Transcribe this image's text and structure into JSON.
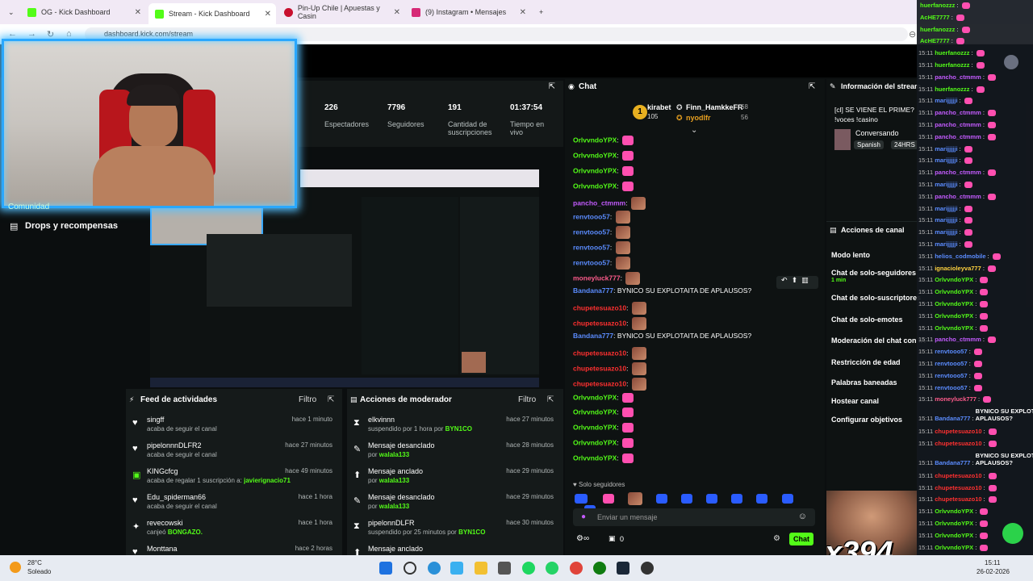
{
  "browser": {
    "tabs": [
      {
        "label": "OG - Kick Dashboard",
        "fav": "#53fc18"
      },
      {
        "label": "Stream - Kick Dashboard",
        "fav": "#53fc18"
      },
      {
        "label": "Pin-Up Chile | Apuestas y Casin",
        "fav": "#c8102e"
      },
      {
        "label": "(9) Instagram • Mensajes",
        "fav": "#d62976"
      }
    ],
    "url": "dashboard.kick.com/stream"
  },
  "stats": [
    {
      "num": "226",
      "label": "Espectadores"
    },
    {
      "num": "7796",
      "label": "Seguidores"
    },
    {
      "num": "191",
      "label": "Cantidad de suscripciones"
    },
    {
      "num": "01:37:54",
      "label": "Tiempo en vivo"
    }
  ],
  "sidebar": {
    "comunidad": "Comunidad",
    "drops": "Drops y recompensas"
  },
  "activity": {
    "title": "Feed de actividades",
    "filter": "Filtro",
    "items": [
      {
        "name": "singff",
        "sub": "acaba de seguir el canal",
        "time": "hace 1 minuto"
      },
      {
        "name": "pipelonnnDLFR2",
        "sub": "acaba de seguir el canal",
        "time": "hace 27 minutos"
      },
      {
        "name": "KINGcfcg",
        "sub": "acaba de regalar 1 suscripción a:",
        "sub2": "javierignacio71",
        "time": "hace 49 minutos"
      },
      {
        "name": "Edu_spiderman66",
        "sub": "acaba de seguir el canal",
        "time": "hace 1 hora"
      },
      {
        "name": "revecowski",
        "sub": "canjeó",
        "sub2": "BONGAZO.",
        "time": "hace 1 hora"
      },
      {
        "name": "Monttana",
        "sub": "",
        "time": "hace 2 horas"
      }
    ]
  },
  "mod": {
    "title": "Acciones de moderador",
    "filter": "Filtro",
    "items": [
      {
        "name": "elkvinnn",
        "sub": "suspendido por 1 hora por",
        "sub2": "BYN1CO",
        "time": "hace 27 minutos"
      },
      {
        "name": "Mensaje desanclado",
        "sub": "por",
        "sub2": "walala133",
        "time": "hace 28 minutos"
      },
      {
        "name": "Mensaje anclado",
        "sub": "por",
        "sub2": "walala133",
        "time": "hace 29 minutos"
      },
      {
        "name": "Mensaje desanclado",
        "sub": "por",
        "sub2": "walala133",
        "time": "hace 29 minutos"
      },
      {
        "name": "pipelonnDLFR",
        "sub": "suspendido por 25 minutos por",
        "sub2": "BYN1CO",
        "time": "hace 30 minutos"
      },
      {
        "name": "Mensaje anclado",
        "sub": "",
        "time": ""
      }
    ]
  },
  "chat": {
    "title": "Chat",
    "leaders": [
      {
        "name": "kirabet",
        "count": "105"
      },
      {
        "name": "Finn_HamkkeFR",
        "count": "68"
      },
      {
        "name": "nyodlfr",
        "count": "56"
      }
    ],
    "messages": [
      {
        "user": "OrlvvndoYPX",
        "color": "#53fc18",
        "text": ""
      },
      {
        "user": "OrlvvndoYPX",
        "color": "#53fc18",
        "text": ""
      },
      {
        "user": "OrlvvndoYPX",
        "color": "#53fc18",
        "text": ""
      },
      {
        "user": "OrlvvndoYPX",
        "color": "#53fc18",
        "text": ""
      },
      {
        "user": "pancho_ctmmm",
        "color": "#c45bff",
        "text": ""
      },
      {
        "user": "renvtooo57",
        "color": "#5b8cff",
        "text": ""
      },
      {
        "user": "renvtooo57",
        "color": "#5b8cff",
        "text": ""
      },
      {
        "user": "renvtooo57",
        "color": "#5b8cff",
        "text": ""
      },
      {
        "user": "renvtooo57",
        "color": "#5b8cff",
        "text": ""
      },
      {
        "user": "moneyluck777",
        "color": "#ff5b8c",
        "text": ""
      },
      {
        "user": "Bandana777",
        "color": "#5b8cff",
        "text": "BYNICO SU EXPLOTAITA DE APLAUSOS?"
      },
      {
        "user": "chupetesuazo10",
        "color": "#ff3030",
        "text": ""
      },
      {
        "user": "chupetesuazo10",
        "color": "#ff3030",
        "text": ""
      },
      {
        "user": "Bandana777",
        "color": "#5b8cff",
        "text": "BYNICO SU EXPLOTAITA DE APLAUSOS?"
      },
      {
        "user": "chupetesuazo10",
        "color": "#ff3030",
        "text": ""
      },
      {
        "user": "chupetesuazo10",
        "color": "#ff3030",
        "text": ""
      },
      {
        "user": "chupetesuazo10",
        "color": "#ff3030",
        "text": ""
      },
      {
        "user": "OrlvvndoYPX",
        "color": "#53fc18",
        "text": ""
      },
      {
        "user": "OrlvvndoYPX",
        "color": "#53fc18",
        "text": ""
      },
      {
        "user": "OrlvvndoYPX",
        "color": "#53fc18",
        "text": ""
      },
      {
        "user": "OrlvvndoYPX",
        "color": "#53fc18",
        "text": ""
      },
      {
        "user": "OrlvvndoYPX",
        "color": "#53fc18",
        "text": ""
      }
    ],
    "followers_only": "Solo seguidores",
    "placeholder": "Enviar un mensaje",
    "viewers_count": "0",
    "send": "Chat"
  },
  "info": {
    "title": "Información del stream",
    "stream_title": "[cl] SE VIENE EL PRIME? !voces !casino",
    "category": "Conversando",
    "tags": [
      "Spanish",
      "24HRS"
    ]
  },
  "actions": {
    "title": "Acciones de canal",
    "items": [
      "Modo lento",
      "Chat de solo-seguidores",
      "Chat de solo-suscriptores",
      "Chat de solo-emotes",
      "Moderación del chat con IA",
      "Restricción de edad",
      "Palabras baneadas",
      "Hostear canal",
      "Configurar objetivos"
    ],
    "followers_duration": "1 min"
  },
  "overlay": {
    "lines": [
      {
        "time": "",
        "user": "huerfanozzz",
        "color": "#53fc18"
      },
      {
        "time": "",
        "user": "AcHE7777",
        "color": "#53fc18"
      },
      {
        "time": "",
        "user": "huerfanozzz",
        "color": "#53fc18"
      },
      {
        "time": "",
        "user": "AcHE7777",
        "color": "#53fc18"
      },
      {
        "time": "15:11",
        "user": "huerfanozzz",
        "color": "#53fc18"
      },
      {
        "time": "15:11",
        "user": "huerfanozzz",
        "color": "#53fc18"
      },
      {
        "time": "15:11",
        "user": "pancho_ctmmm",
        "color": "#c45bff"
      },
      {
        "time": "15:11",
        "user": "huerfanozzz",
        "color": "#53fc18"
      },
      {
        "time": "15:11",
        "user": "marijjjjji",
        "color": "#5b8cff"
      },
      {
        "time": "15:11",
        "user": "pancho_ctmmm",
        "color": "#c45bff"
      },
      {
        "time": "15:11",
        "user": "pancho_ctmmm",
        "color": "#c45bff"
      },
      {
        "time": "15:11",
        "user": "pancho_ctmmm",
        "color": "#c45bff"
      },
      {
        "time": "15:11",
        "user": "marijjjjji",
        "color": "#5b8cff"
      },
      {
        "time": "15:11",
        "user": "marijjjjji",
        "color": "#5b8cff"
      },
      {
        "time": "15:11",
        "user": "pancho_ctmmm",
        "color": "#c45bff"
      },
      {
        "time": "15:11",
        "user": "marijjjjji",
        "color": "#5b8cff"
      },
      {
        "time": "15:11",
        "user": "pancho_ctmmm",
        "color": "#c45bff"
      },
      {
        "time": "15:11",
        "user": "marijjjjji",
        "color": "#5b8cff"
      },
      {
        "time": "15:11",
        "user": "marijjjjji",
        "color": "#5b8cff"
      },
      {
        "time": "15:11",
        "user": "marijjjjji",
        "color": "#5b8cff"
      },
      {
        "time": "15:11",
        "user": "marijjjjji",
        "color": "#5b8cff"
      },
      {
        "time": "15:11",
        "user": "helios_codmobile",
        "color": "#5b8cff"
      },
      {
        "time": "15:11",
        "user": "ignacioleyva777",
        "color": "#ffd23f"
      },
      {
        "time": "15:11",
        "user": "OrlvvndoYPX",
        "color": "#53fc18"
      },
      {
        "time": "15:11",
        "user": "OrlvvndoYPX",
        "color": "#53fc18"
      },
      {
        "time": "15:11",
        "user": "OrlvvndoYPX",
        "color": "#53fc18"
      },
      {
        "time": "15:11",
        "user": "OrlvvndoYPX",
        "color": "#53fc18"
      },
      {
        "time": "15:11",
        "user": "OrlvvndoYPX",
        "color": "#53fc18"
      },
      {
        "time": "15:11",
        "user": "pancho_ctmmm",
        "color": "#c45bff"
      },
      {
        "time": "15:11",
        "user": "renvtooo57",
        "color": "#5b8cff"
      },
      {
        "time": "15:11",
        "user": "renvtooo57",
        "color": "#5b8cff"
      },
      {
        "time": "15:11",
        "user": "renvtooo57",
        "color": "#5b8cff"
      },
      {
        "time": "15:11",
        "user": "renvtooo57",
        "color": "#5b8cff"
      },
      {
        "time": "15:11",
        "user": "moneyluck777",
        "color": "#ff5b8c"
      },
      {
        "time": "15:11",
        "user": "Bandana777",
        "color": "#5b8cff",
        "text": "BYNICO SU EXPLOTAITA DE APLAUSOS?"
      },
      {
        "time": "15:11",
        "user": "chupetesuazo10",
        "color": "#ff3030"
      },
      {
        "time": "15:11",
        "user": "chupetesuazo10",
        "color": "#ff3030"
      },
      {
        "time": "15:11",
        "user": "Bandana777",
        "color": "#5b8cff",
        "text": "BYNICO SU EXPLOTAITA DE APLAUSOS?"
      },
      {
        "time": "15:11",
        "user": "chupetesuazo10",
        "color": "#ff3030"
      },
      {
        "time": "15:11",
        "user": "chupetesuazo10",
        "color": "#ff3030"
      },
      {
        "time": "15:11",
        "user": "chupetesuazo10",
        "color": "#ff3030"
      },
      {
        "time": "15:11",
        "user": "OrlvvndoYPX",
        "color": "#53fc18"
      },
      {
        "time": "15:11",
        "user": "OrlvvndoYPX",
        "color": "#53fc18"
      },
      {
        "time": "15:11",
        "user": "OrlvvndoYPX",
        "color": "#53fc18"
      },
      {
        "time": "15:11",
        "user": "OrlvvndoYPX",
        "color": "#53fc18"
      }
    ]
  },
  "overlay_counter": "x394",
  "taskbar": {
    "weather_temp": "28°C",
    "weather_desc": "Soleado",
    "time": "15:11",
    "date": "26-02-2026"
  }
}
